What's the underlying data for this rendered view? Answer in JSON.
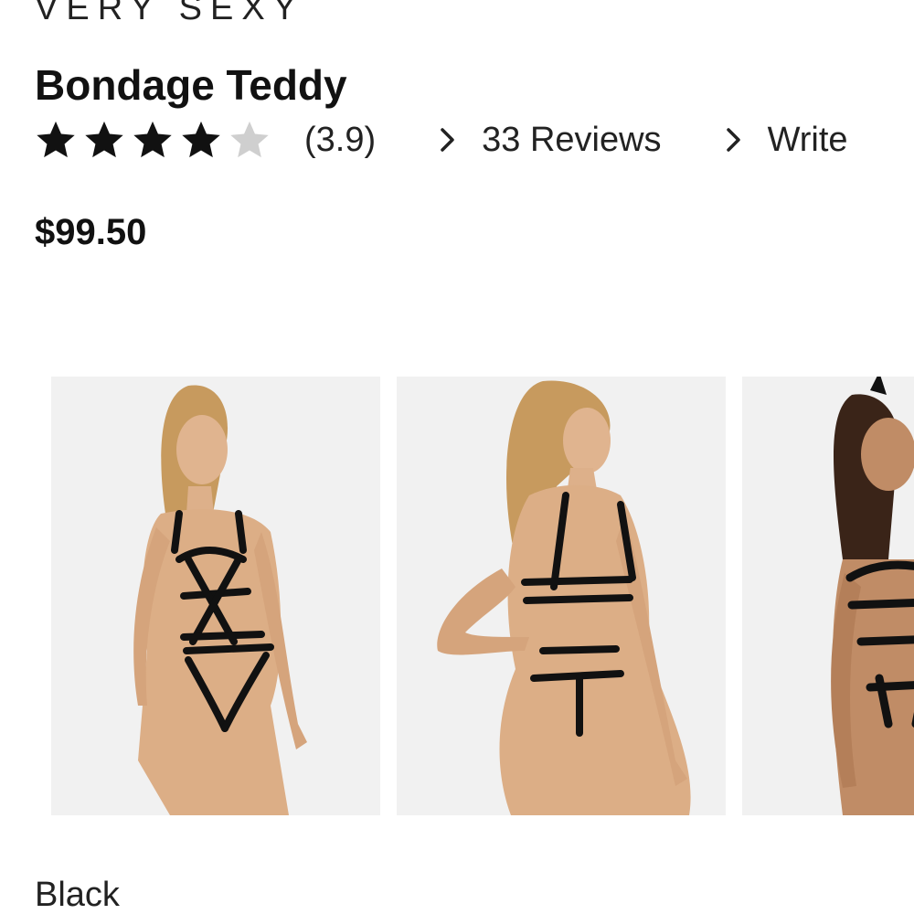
{
  "product": {
    "brand": "VERY SEXY",
    "name": "Bondage Teddy",
    "rating": 3.9,
    "rating_max": 5,
    "rating_label": "(3.9)",
    "reviews_link": "33 Reviews",
    "write_link": "Write",
    "price": "$99.50",
    "color": "Black"
  },
  "icons": {
    "star_filled": "star-icon",
    "star_empty": "star-outline-icon",
    "chevron": "chevron-right-icon"
  },
  "colors": {
    "star_filled": "#111111",
    "star_empty": "#cfcfcf",
    "text": "#1a1a1a",
    "image_background": "#f1f1f1"
  }
}
